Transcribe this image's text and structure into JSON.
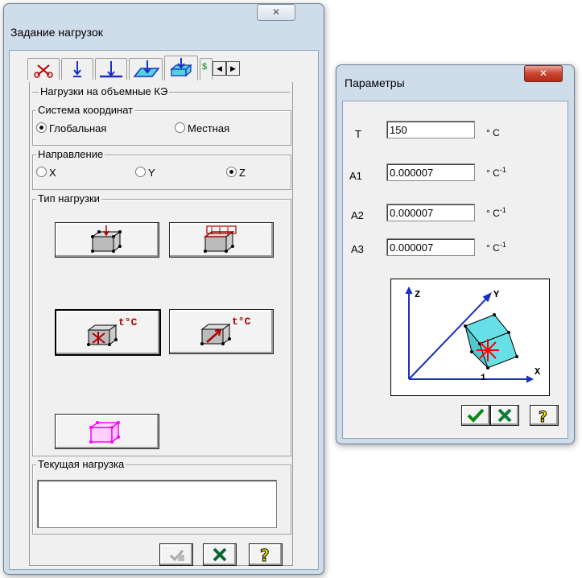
{
  "load_window": {
    "title": "Задание нагрузок",
    "close_glyph": "✕",
    "tabs": [
      {
        "icon": "scissors-icon"
      },
      {
        "icon": "node-force-icon"
      },
      {
        "icon": "bar-load-icon"
      },
      {
        "icon": "plate-load-icon"
      },
      {
        "icon": "volume-load-icon"
      },
      {
        "icon": "partial-tab-icon"
      }
    ],
    "tab_partial_label": "$",
    "scroll_left": "◀",
    "scroll_right": "▶",
    "section_title": "Нагрузки на объемные КЭ",
    "coord_system": {
      "legend": "Система координат",
      "options": [
        {
          "label": "Глобальная",
          "selected": true
        },
        {
          "label": "Местная",
          "selected": false
        }
      ]
    },
    "direction": {
      "legend": "Направление",
      "options": [
        {
          "label": "X",
          "selected": false
        },
        {
          "label": "Y",
          "selected": false
        },
        {
          "label": "Z",
          "selected": true
        }
      ]
    },
    "load_type": {
      "legend": "Тип нагрузки",
      "temp_label": "t°C"
    },
    "current_load": {
      "legend": "Текущая нагрузка",
      "value": ""
    }
  },
  "params_window": {
    "title": "Параметры",
    "close_glyph": "✕",
    "rows": [
      {
        "label": "T",
        "value": "150",
        "unit": "° C",
        "unit_sup": ""
      },
      {
        "label": "A1",
        "value": "0.000007",
        "unit": "° C",
        "unit_sup": "-1"
      },
      {
        "label": "A2",
        "value": "0.000007",
        "unit": "° C",
        "unit_sup": "-1"
      },
      {
        "label": "A3",
        "value": "0.000007",
        "unit": "° C",
        "unit_sup": "-1"
      }
    ],
    "axes": {
      "z": "Z",
      "y": "Y",
      "x": "X",
      "one": "1"
    }
  },
  "colors": {
    "accent_red": "#b00000",
    "ok_green": "#0a8a1a",
    "cancel_green": "#127a3a",
    "help_yellow": "#f2e600",
    "magenta": "#ff00ff",
    "cube_cyan": "#66e0e6"
  }
}
